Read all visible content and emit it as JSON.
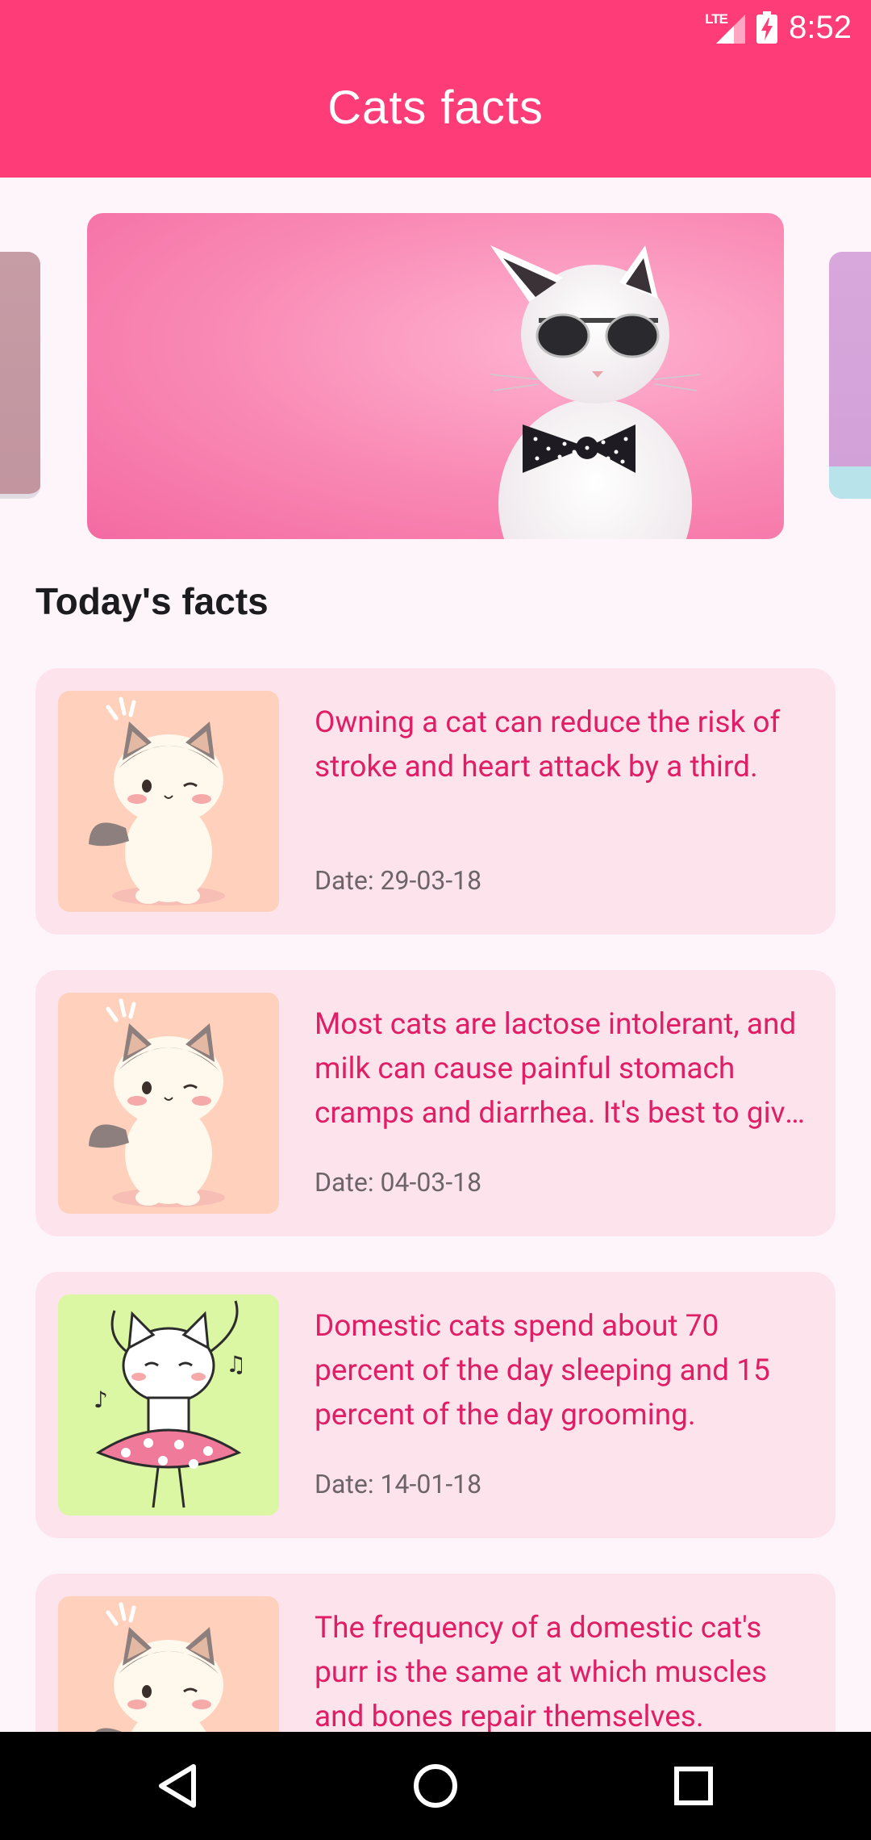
{
  "status_bar": {
    "network": "LTE",
    "time": "8:52"
  },
  "app_bar": {
    "title": "Cats facts"
  },
  "carousel": {
    "hero_image": "cat-with-sunglasses-and-bow-tie",
    "items_visible": 3
  },
  "section": {
    "title": "Today's facts"
  },
  "facts": [
    {
      "text": "Owning a cat can reduce the risk of stroke and heart attack by a third.",
      "date": "Date: 29-03-18",
      "thumb": "kitten-waving"
    },
    {
      "text": "Most cats are lactose intolerant, and milk can cause painful stomach cramps and diarrhea. It's best to give them water.",
      "date": "Date: 04-03-18",
      "thumb": "kitten-waving"
    },
    {
      "text": "Domestic cats spend about 70 percent of the day sleeping and 15 percent of the day grooming.",
      "date": "Date: 14-01-18",
      "thumb": "cat-dancing-tutu"
    },
    {
      "text": "The frequency of a domestic cat's purr is the same at which muscles and bones repair themselves.",
      "date": "",
      "thumb": "kitten-waving"
    }
  ],
  "colors": {
    "primary": "#fe3d78",
    "background": "#fdf5fa",
    "card": "#fde3ec",
    "fact_text": "#e01e66",
    "date_text": "#6d6469"
  }
}
